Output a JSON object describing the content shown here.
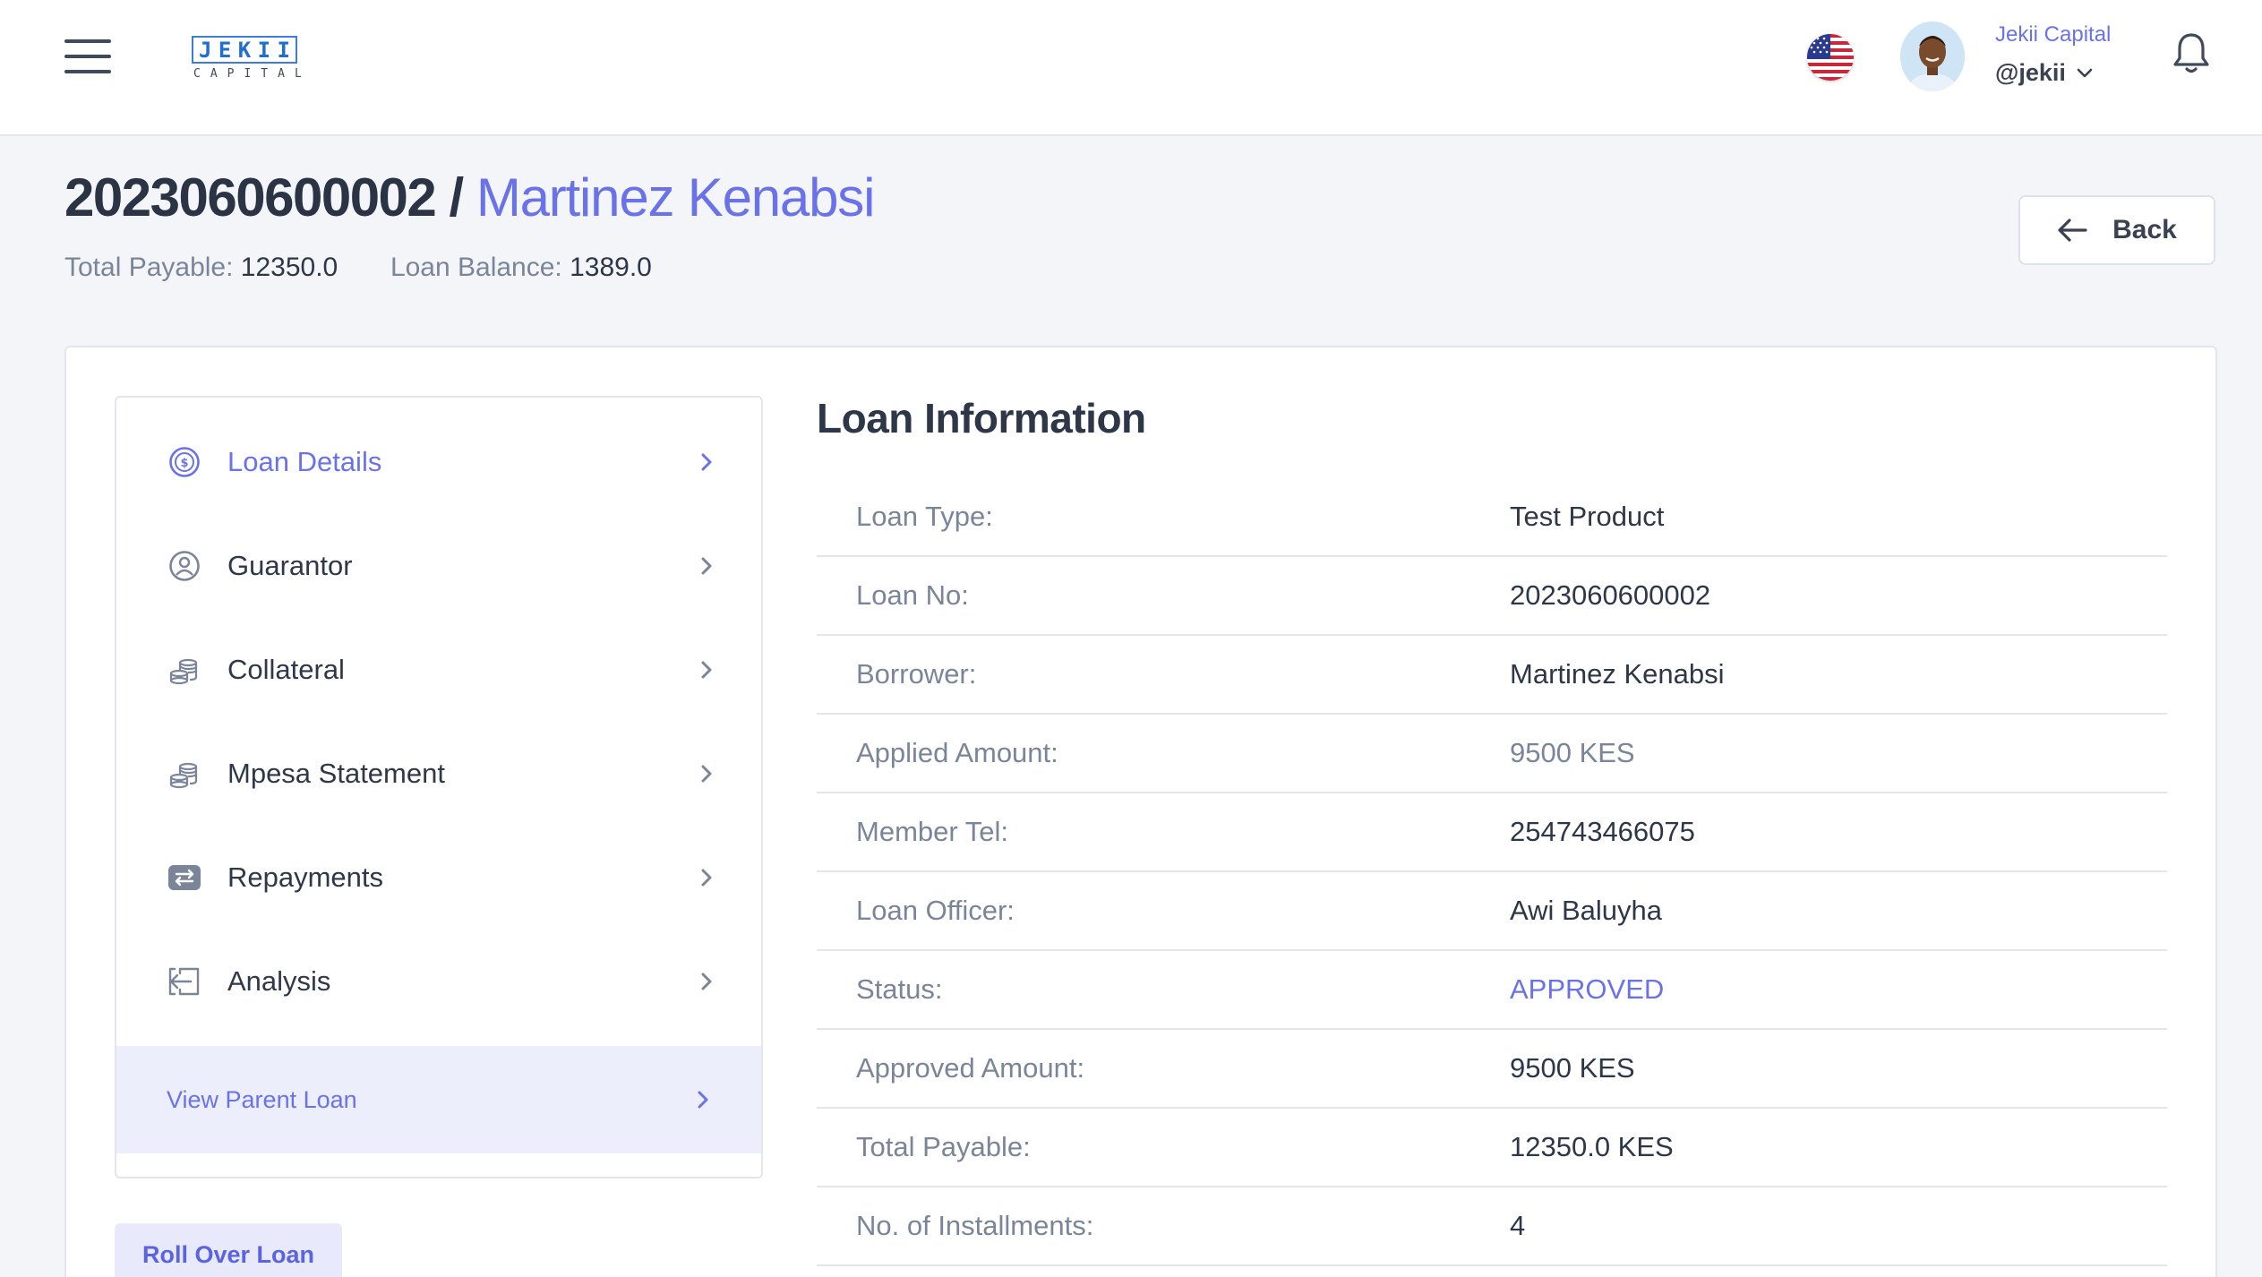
{
  "brand": {
    "logo_top": [
      "J",
      "E",
      "K",
      "I",
      "I"
    ],
    "logo_bottom": "CAPITAL"
  },
  "user": {
    "org": "Jekii Capital",
    "handle": "@jekii"
  },
  "icons": {
    "menu": "hamburger-icon",
    "language": "us-flag-icon",
    "notifications": "bell-icon",
    "back": "arrow-left-icon",
    "dropdown": "chevron-down-icon"
  },
  "header": {
    "loan_number": "2023060600002",
    "separator": "/",
    "borrower_name": "Martinez Kenabsi",
    "total_payable_label": "Total Payable:",
    "total_payable_value": "12350.0",
    "loan_balance_label": "Loan Balance:",
    "loan_balance_value": "1389.0",
    "back_label": "Back"
  },
  "side_menu": {
    "items": [
      {
        "label": "Loan Details",
        "icon": "dollar-circle-icon",
        "active": true
      },
      {
        "label": "Guarantor",
        "icon": "user-circle-icon",
        "active": false
      },
      {
        "label": "Collateral",
        "icon": "coins-stack-icon",
        "active": false
      },
      {
        "label": "Mpesa Statement",
        "icon": "coins-stack-icon",
        "active": false
      },
      {
        "label": "Repayments",
        "icon": "transfer-icon",
        "active": false
      },
      {
        "label": "Analysis",
        "icon": "sign-in-icon",
        "active": false
      }
    ],
    "parent_loan_label": "View Parent Loan",
    "rollover_label": "Roll Over Loan"
  },
  "loan_info": {
    "title": "Loan Information",
    "rows": [
      {
        "key": "Loan Type:",
        "value": "Test Product"
      },
      {
        "key": "Loan No:",
        "value": "2023060600002"
      },
      {
        "key": "Borrower:",
        "value": "Martinez Kenabsi"
      },
      {
        "key": "Applied Amount:",
        "value": "9500 KES"
      },
      {
        "key": "Member Tel:",
        "value": "254743466075"
      },
      {
        "key": "Loan Officer:",
        "value": "Awi Baluyha"
      },
      {
        "key": "Status:",
        "value": "APPROVED"
      },
      {
        "key": "Approved Amount:",
        "value": "9500 KES"
      },
      {
        "key": "Total Payable:",
        "value": "12350.0 KES"
      },
      {
        "key": "No. of Installments:",
        "value": "4"
      }
    ]
  },
  "colors": {
    "accent": "#6a72ea",
    "muted_text": "#7a8599",
    "heading_text": "#2d3748",
    "page_bg": "#f4f5f9"
  }
}
